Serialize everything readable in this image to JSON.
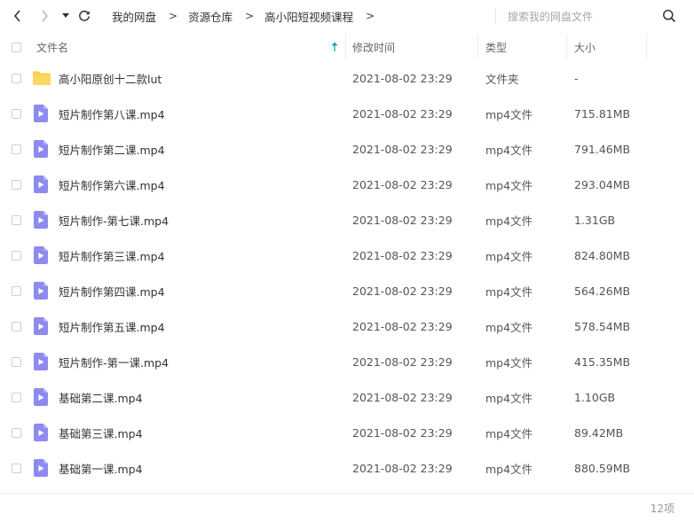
{
  "breadcrumb": [
    {
      "label": "我的网盘"
    },
    {
      "label": "资源仓库"
    },
    {
      "label": "高小阳短视频课程"
    }
  ],
  "breadcrumb_separator": ">",
  "search": {
    "placeholder": "搜索我的网盘文件"
  },
  "header": {
    "name": "文件名",
    "modified": "修改时间",
    "type": "类型",
    "size": "大小"
  },
  "rows": [
    {
      "name": "高小阳原创十二款lut",
      "date": "2021-08-02 23:29",
      "type": "文件夹",
      "size": "-",
      "icon": "folder-icon"
    },
    {
      "name": "短片制作第八课.mp4",
      "date": "2021-08-02 23:29",
      "type": "mp4文件",
      "size": "715.81MB",
      "icon": "video-file-icon"
    },
    {
      "name": "短片制作第二课.mp4",
      "date": "2021-08-02 23:29",
      "type": "mp4文件",
      "size": "791.46MB",
      "icon": "video-file-icon"
    },
    {
      "name": "短片制作第六课.mp4",
      "date": "2021-08-02 23:29",
      "type": "mp4文件",
      "size": "293.04MB",
      "icon": "video-file-icon"
    },
    {
      "name": "短片制作-第七课.mp4",
      "date": "2021-08-02 23:29",
      "type": "mp4文件",
      "size": "1.31GB",
      "icon": "video-file-icon"
    },
    {
      "name": "短片制作第三课.mp4",
      "date": "2021-08-02 23:29",
      "type": "mp4文件",
      "size": "824.80MB",
      "icon": "video-file-icon"
    },
    {
      "name": "短片制作第四课.mp4",
      "date": "2021-08-02 23:29",
      "type": "mp4文件",
      "size": "564.26MB",
      "icon": "video-file-icon"
    },
    {
      "name": "短片制作第五课.mp4",
      "date": "2021-08-02 23:29",
      "type": "mp4文件",
      "size": "578.54MB",
      "icon": "video-file-icon"
    },
    {
      "name": "短片制作-第一课.mp4",
      "date": "2021-08-02 23:29",
      "type": "mp4文件",
      "size": "415.35MB",
      "icon": "video-file-icon"
    },
    {
      "name": "基础第二课.mp4",
      "date": "2021-08-02 23:29",
      "type": "mp4文件",
      "size": "1.10GB",
      "icon": "video-file-icon"
    },
    {
      "name": "基础第三课.mp4",
      "date": "2021-08-02 23:29",
      "type": "mp4文件",
      "size": "89.42MB",
      "icon": "video-file-icon"
    },
    {
      "name": "基础第一课.mp4",
      "date": "2021-08-02 23:29",
      "type": "mp4文件",
      "size": "880.59MB",
      "icon": "video-file-icon"
    }
  ],
  "footer": {
    "count": "12项"
  },
  "colors": {
    "folder": "#f9cf4a",
    "video_file": "#8d8af0",
    "sort_arrow": "#19a6a6",
    "divider": "#ededed"
  },
  "icons": {
    "back": "chevron-left-icon",
    "forward": "chevron-right-icon",
    "history": "caret-down-icon",
    "refresh": "refresh-icon",
    "search": "search-icon",
    "sort": "sort-arrow-up-icon"
  }
}
